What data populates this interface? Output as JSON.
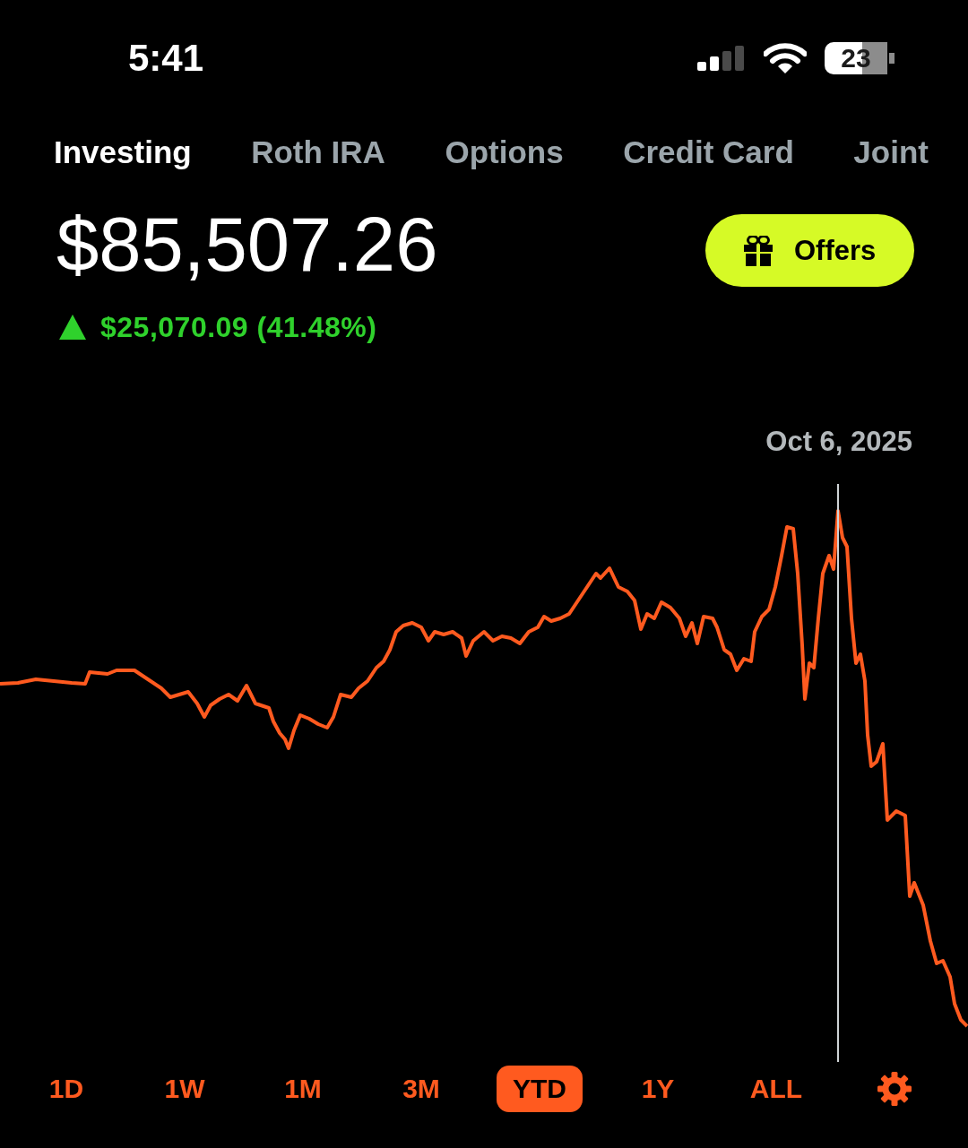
{
  "status_bar": {
    "time": "5:41",
    "battery": "23"
  },
  "account_tabs": [
    {
      "label": "Investing",
      "selected": true
    },
    {
      "label": "Roth IRA",
      "selected": false
    },
    {
      "label": "Options",
      "selected": false
    },
    {
      "label": "Credit Card",
      "selected": false
    },
    {
      "label": "Joint",
      "selected": false
    }
  ],
  "portfolio": {
    "balance": "$85,507.26",
    "change": "$25,070.09 (41.48%)",
    "gain": true
  },
  "offers_button": {
    "label": "Offers"
  },
  "chart": {
    "date_label": "Oct 6, 2025"
  },
  "time_ranges": [
    {
      "label": "1D",
      "selected": false
    },
    {
      "label": "1W",
      "selected": false
    },
    {
      "label": "1M",
      "selected": false
    },
    {
      "label": "3M",
      "selected": false
    },
    {
      "label": "YTD",
      "selected": true
    },
    {
      "label": "1Y",
      "selected": false
    },
    {
      "label": "ALL",
      "selected": false
    }
  ]
}
